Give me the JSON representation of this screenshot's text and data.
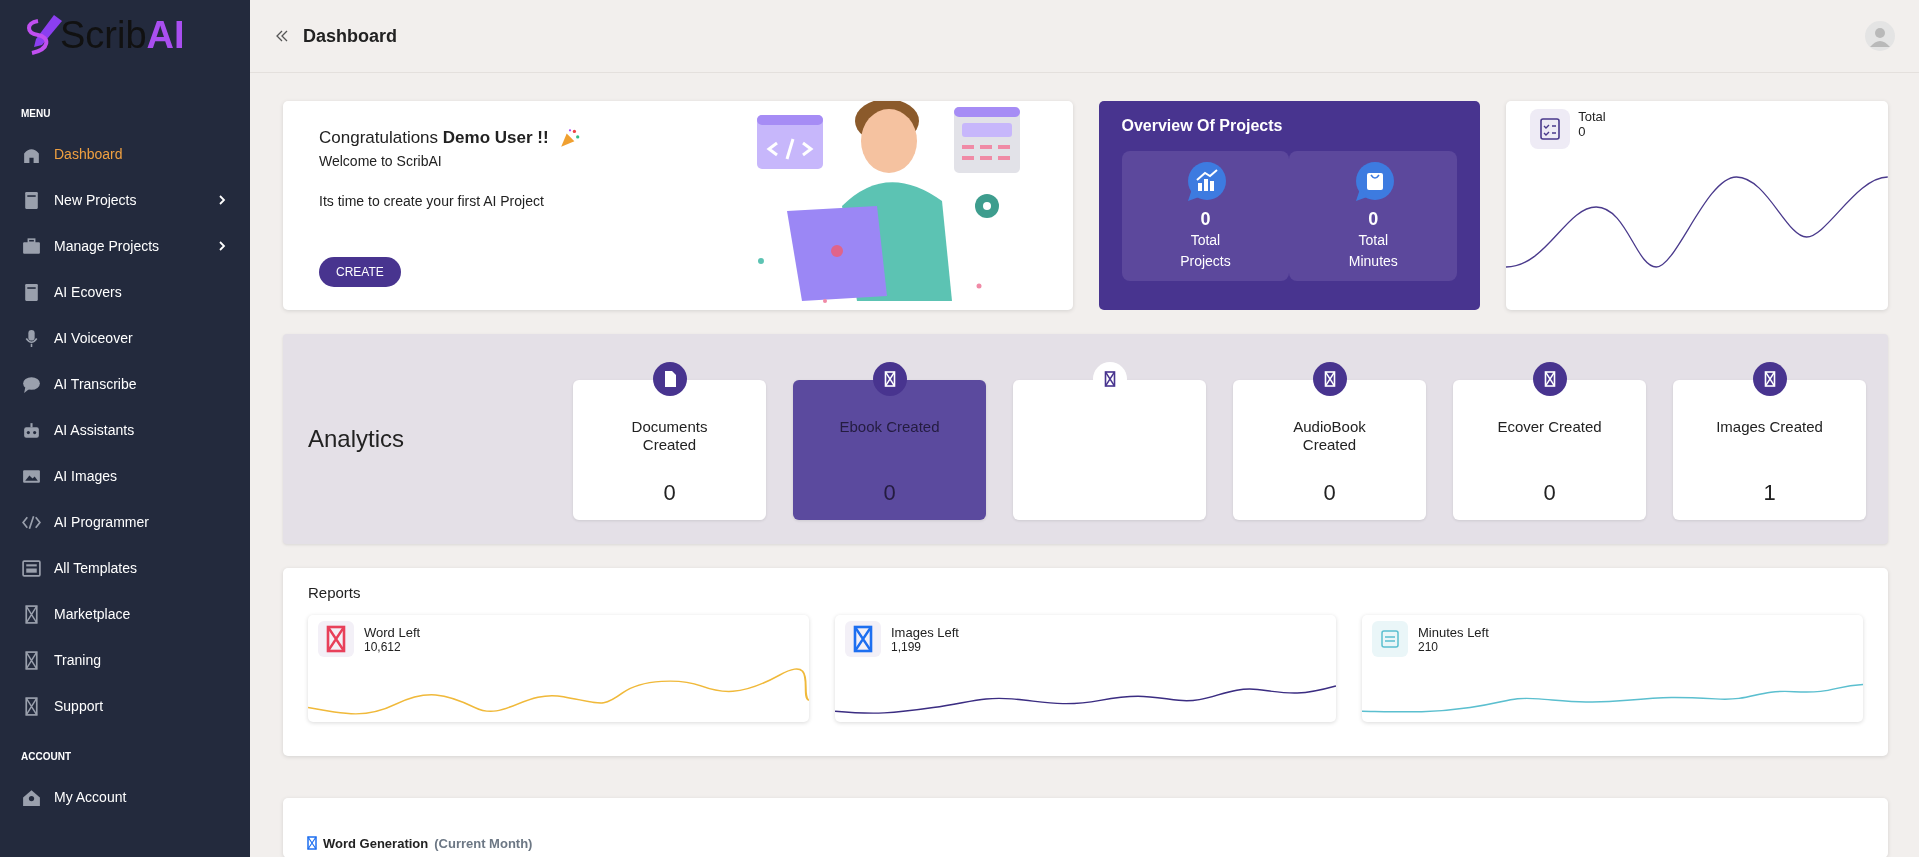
{
  "brand": {
    "name": "Scrib",
    "accent": "AI"
  },
  "sidebar": {
    "sections": [
      {
        "title": "MENU",
        "items": [
          {
            "label": "Dashboard",
            "selected": true,
            "submenu": false
          },
          {
            "label": "New Projects",
            "selected": false,
            "submenu": true
          },
          {
            "label": "Manage Projects",
            "selected": false,
            "submenu": true
          },
          {
            "label": "AI Ecovers",
            "selected": false,
            "submenu": false
          },
          {
            "label": "AI Voiceover",
            "selected": false,
            "submenu": false
          },
          {
            "label": "AI Transcribe",
            "selected": false,
            "submenu": false
          },
          {
            "label": "AI Assistants",
            "selected": false,
            "submenu": false
          },
          {
            "label": "AI Images",
            "selected": false,
            "submenu": false
          },
          {
            "label": "AI Programmer",
            "selected": false,
            "submenu": false
          },
          {
            "label": "All Templates",
            "selected": false,
            "submenu": false
          },
          {
            "label": "Marketplace",
            "selected": false,
            "submenu": false
          },
          {
            "label": "Traning",
            "selected": false,
            "submenu": false
          },
          {
            "label": "Support",
            "selected": false,
            "submenu": false
          }
        ]
      },
      {
        "title": "ACCOUNT",
        "items": [
          {
            "label": "My Account",
            "selected": false,
            "submenu": false
          }
        ]
      }
    ]
  },
  "header": {
    "title": "Dashboard"
  },
  "welcome": {
    "greeting": "Congratulations **Demo User !!**",
    "subtitle": "Welcome to ScribAI",
    "message": "Its time to create your first AI Project",
    "button": "CREATE"
  },
  "overview": {
    "title": "Overview Of Projects",
    "stats": [
      {
        "value": "0",
        "label": "Total Projects"
      },
      {
        "value": "0",
        "label": "Total Minutes"
      }
    ]
  },
  "total": {
    "label": "Total",
    "value": "0"
  },
  "analytics": {
    "title": "Analytics",
    "cards": [
      {
        "kind": "document",
        "label": "Documents Created",
        "value": "0",
        "highlighted": false,
        "hovered": false
      },
      {
        "kind": "placeholder",
        "label": "Ebook Created",
        "value": "0",
        "highlighted": true,
        "hovered": false
      },
      {
        "kind": "placeholder",
        "highlighted": false,
        "hovered": true
      },
      {
        "kind": "placeholder",
        "label": "AudioBook Created",
        "value": "0",
        "highlighted": false,
        "hovered": false
      },
      {
        "kind": "placeholder",
        "label": "Ecover Created",
        "value": "0",
        "highlighted": false,
        "hovered": false
      },
      {
        "kind": "placeholder",
        "label": "Images Created",
        "value": "1",
        "highlighted": false,
        "hovered": false
      }
    ]
  },
  "reports": {
    "title": "Reports",
    "items": [
      {
        "kind": "placeholder",
        "label": "Word Left",
        "value": "10,612",
        "color": "#f0b93a"
      },
      {
        "kind": "placeholder",
        "label": "Images Left",
        "value": "1,199",
        "color": "#3b2d82"
      },
      {
        "kind": "calendar",
        "label": "Minutes Left",
        "value": "210",
        "color": "#5bbfcf"
      }
    ]
  },
  "word_generation": {
    "title": "Word Generation",
    "note": "(Current Month)"
  }
}
